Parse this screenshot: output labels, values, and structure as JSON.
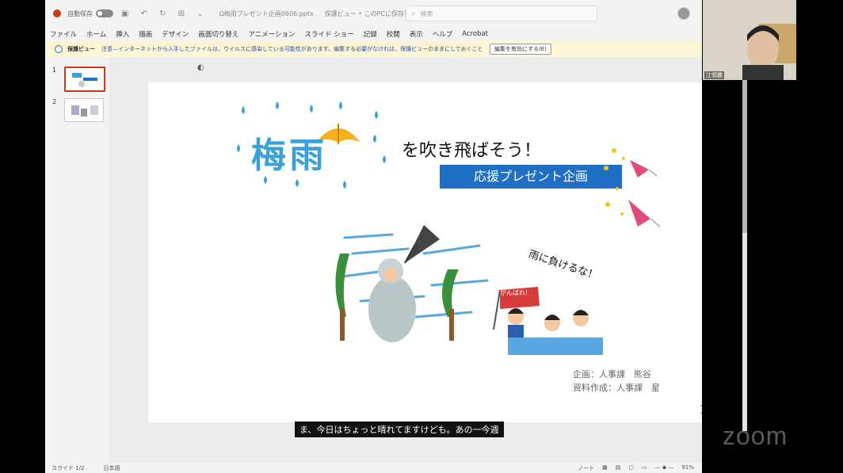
{
  "titlebar": {
    "autosave": "自動保存",
    "autosave_state": "オフ",
    "filename": "Ω梅雨プレゼント企画0606.pptx",
    "status": "保護ビュー • このPCに保存済み",
    "search_placeholder": "検索"
  },
  "menu": [
    "ファイル",
    "ホーム",
    "挿入",
    "描画",
    "デザイン",
    "画面切り替え",
    "アニメーション",
    "スライド ショー",
    "記録",
    "校閲",
    "表示",
    "ヘルプ",
    "Acrobat"
  ],
  "protected_view": {
    "label": "保護ビュー",
    "message": "注意—インターネットから入手したファイルは、ウイルスに感染している可能性があります。編集する必要がなければ、保護ビューのままにしておくことをお勧めします。",
    "enable_button": "編集を有効にする(E)"
  },
  "thumbnails": [
    {
      "num": "1"
    },
    {
      "num": "2"
    }
  ],
  "slide": {
    "title_kanji": "梅雨",
    "title_rest": "を吹き飛ばそう！",
    "subtitle": "応援プレゼント企画",
    "cheer_text": "雨に負けるな！",
    "flag_text": "がんばれ!",
    "credit_planning": "企画：人事課　熊谷",
    "credit_docs": "資料作成：人事課　星",
    "page_number": "1"
  },
  "statusbar": {
    "slide_info": "スライド 1/2",
    "language": "日本語",
    "notes": "ノート",
    "zoom": "91%"
  },
  "camera": {
    "name": "江領麗"
  },
  "caption": "ま、今日はちょっと晴れてますけども。あの一今週",
  "watermark": "zoom",
  "colors": {
    "accent": "#c43e1c",
    "subtitle_bg": "#1f6fc4",
    "rain_blue": "#3aa0d8",
    "umbrella": "#f5b21a"
  }
}
